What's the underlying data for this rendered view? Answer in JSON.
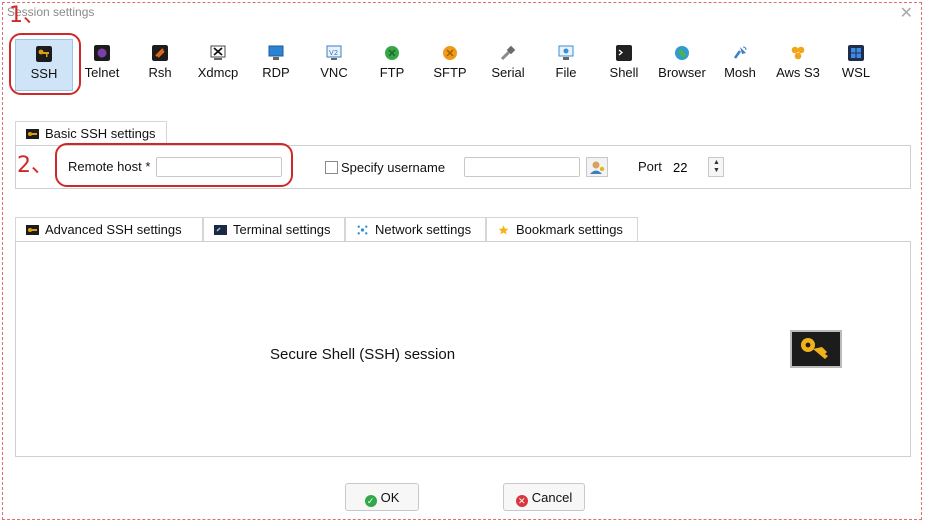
{
  "window": {
    "title": "Session settings",
    "close_glyph": "✕"
  },
  "annotations": {
    "step1": "1、",
    "step2": "2、",
    "color": "#d02828"
  },
  "toolbar": {
    "items": [
      {
        "label": "SSH",
        "icon": "key-icon",
        "color": "#d8a013"
      },
      {
        "label": "Telnet",
        "icon": "telnet-icon",
        "color": "#7b3fa8"
      },
      {
        "label": "Rsh",
        "icon": "rsh-icon",
        "color": "#e06a1a"
      },
      {
        "label": "Xdmcp",
        "icon": "xdmcp-icon",
        "color": "#444444"
      },
      {
        "label": "RDP",
        "icon": "rdp-icon",
        "color": "#2b84d2"
      },
      {
        "label": "VNC",
        "icon": "vnc-icon",
        "color": "#3b7ec2"
      },
      {
        "label": "FTP",
        "icon": "ftp-icon",
        "color": "#36a648"
      },
      {
        "label": "SFTP",
        "icon": "sftp-icon",
        "color": "#f09a1a"
      },
      {
        "label": "Serial",
        "icon": "serial-icon",
        "color": "#8a8a8a"
      },
      {
        "label": "File",
        "icon": "file-icon",
        "color": "#3b8fd4"
      },
      {
        "label": "Shell",
        "icon": "shell-icon",
        "color": "#222222"
      },
      {
        "label": "Browser",
        "icon": "browser-icon",
        "color": "#2f9bd6"
      },
      {
        "label": "Mosh",
        "icon": "mosh-icon",
        "color": "#3c7fc4"
      },
      {
        "label": "Aws S3",
        "icon": "aws-s3-icon",
        "color": "#f2a516"
      },
      {
        "label": "WSL",
        "icon": "wsl-icon",
        "color": "#1e6fc9"
      }
    ]
  },
  "basic": {
    "tab_label": "Basic SSH settings",
    "remote_host_label": "Remote host *",
    "remote_host_value": "",
    "specify_username_label": "Specify username",
    "username_value": "",
    "port_label": "Port",
    "port_value": "22"
  },
  "advanced_tabs": [
    {
      "label": "Advanced SSH settings",
      "icon": "key-icon",
      "color": "#d8a013"
    },
    {
      "label": "Terminal settings",
      "icon": "terminal-icon",
      "color": "#3b6fb0"
    },
    {
      "label": "Network settings",
      "icon": "network-icon",
      "color": "#2f8fd4"
    },
    {
      "label": "Bookmark settings",
      "icon": "star-icon",
      "color": "#f2b616"
    }
  ],
  "session_description": "Secure Shell (SSH) session",
  "buttons": {
    "ok_label": "OK",
    "cancel_label": "Cancel",
    "ok_color": "#33a84a",
    "cancel_color": "#d8373d"
  }
}
